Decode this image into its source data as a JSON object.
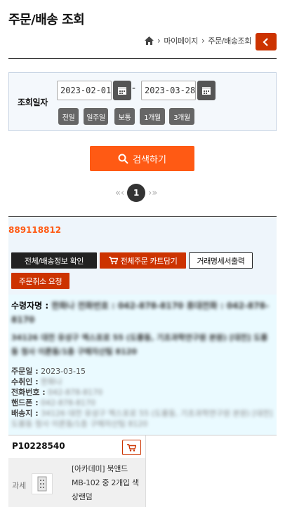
{
  "header": {
    "title": "주문/배송 조회"
  },
  "breadcrumb": {
    "items": [
      "마이페이지",
      "주문/배송조회"
    ]
  },
  "search": {
    "label": "조회일자",
    "start_date": "2023-02-01",
    "end_date": "2023-03-28",
    "separator": "-",
    "quick_ranges": [
      "전일",
      "일주일",
      "보통",
      "1개월",
      "3개월"
    ],
    "submit_label": "검색하기"
  },
  "pagination": {
    "prev": "«‹",
    "current": "1",
    "next": "›»"
  },
  "order": {
    "number": "889118812",
    "buttons": {
      "detail": "전체/배송정보 확인",
      "cart_all": "전체주문 카트담기",
      "statement": "거래명세서출력",
      "cancel": "주문취소 요청"
    },
    "recipient_label": "수령자명 :",
    "recipient_blurred": "한화나 전화번호 : 042-878-8170 휴대전화 : 042-878-8170",
    "address_blurred": "34126 대전 유성구 엑스포로 55 (도룡동, 기초과학연구원 본원) [대전] 도룡동 청사 이론동/1층 구매자산팀 8120",
    "order_date_label": "주문일 :",
    "order_date": "2023-03-15",
    "receiver_label": "수취인 :",
    "receiver_blurred": "한화나",
    "phone_label": "전화번호 :",
    "phone_blurred": "042-878-8170",
    "mobile_label": "핸드폰 :",
    "mobile_blurred": "042-878-8170",
    "ship_label": "배송지 :",
    "ship_blurred": "34126 대전 유성구 엑스포로 55 (도룡동, 기초과학연구원 본원) [대전] 도룡동 청사 이론동/1층 구매자산팀 8120"
  },
  "product": {
    "code": "P10228540",
    "tax": "과세",
    "name": "[아카데미] 북앤드 MB-102 중 2개입 색상랜덤"
  },
  "colors": {
    "accent": "#ff5a14",
    "danger": "#cc3300",
    "dark": "#222222"
  }
}
